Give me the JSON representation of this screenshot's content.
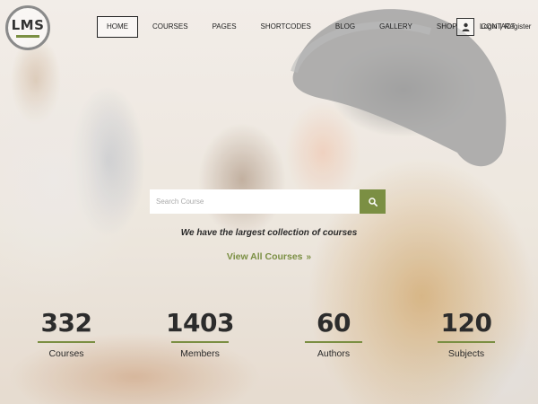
{
  "logo": {
    "text": "LMS"
  },
  "nav": {
    "items": [
      {
        "label": "HOME"
      },
      {
        "label": "COURSES"
      },
      {
        "label": "PAGES"
      },
      {
        "label": "SHORTCODES"
      },
      {
        "label": "BLOG"
      },
      {
        "label": "GALLERY"
      },
      {
        "label": "SHOP"
      },
      {
        "label": "CONTACT"
      }
    ],
    "active": "HOME"
  },
  "auth": {
    "login": "Login",
    "separator": "|",
    "register": "Register",
    "user_icon": "user-icon"
  },
  "search": {
    "placeholder": "Search Course",
    "value": "",
    "button_icon": "search-icon"
  },
  "hero": {
    "tagline": "We have the largest collection of courses",
    "cta_label": "View All Courses",
    "cta_icon": "double-chevron-right-icon"
  },
  "stats": [
    {
      "value": "332",
      "label": "Courses"
    },
    {
      "value": "1403",
      "label": "Members"
    },
    {
      "value": "60",
      "label": "Authors"
    },
    {
      "value": "120",
      "label": "Subjects"
    }
  ],
  "colors": {
    "accent": "#7b8f43",
    "text": "#2c2c2c"
  }
}
